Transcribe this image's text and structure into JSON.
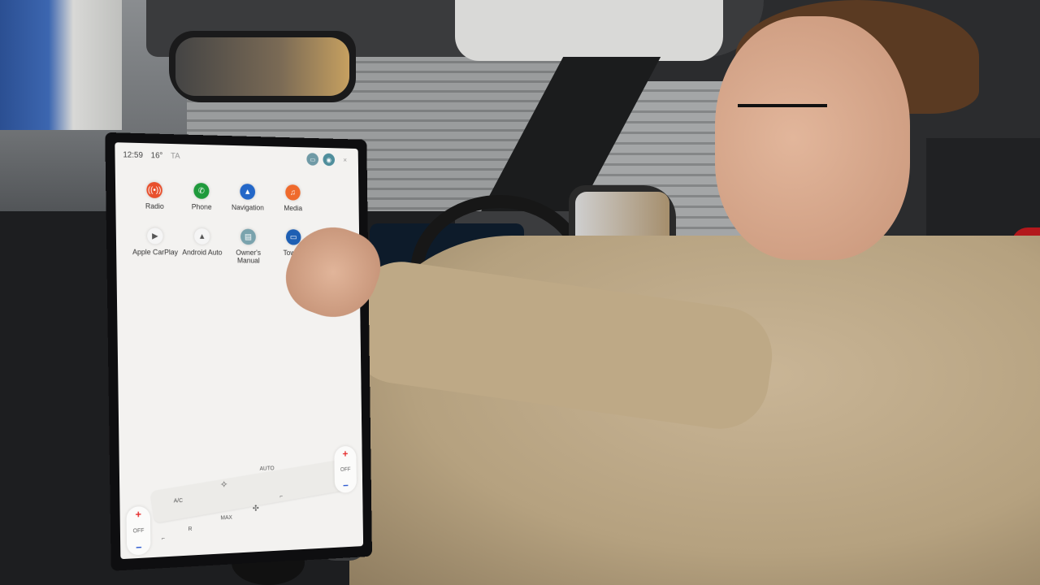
{
  "scene": {
    "description": "Driver touching a portrait infotainment touchscreen in a vehicle cabin"
  },
  "screen": {
    "status_bar": {
      "time": "12:59",
      "temperature": "16°",
      "radio_indicator": "TA",
      "icons": [
        "display-icon",
        "camera-icon",
        "close-icon"
      ],
      "close_label": "×"
    },
    "apps": [
      {
        "label": "Radio",
        "icon": "radio-icon",
        "glyph": "((•))",
        "color": "#e8502d"
      },
      {
        "label": "Phone",
        "icon": "phone-icon",
        "glyph": "✆",
        "color": "#1f9a3c"
      },
      {
        "label": "Navigation",
        "icon": "navigation-icon",
        "glyph": "▲",
        "color": "#2367c8"
      },
      {
        "label": "Media",
        "icon": "music-icon",
        "glyph": "♫",
        "color": "#ef6a2c"
      },
      {
        "label": "Apple CarPlay",
        "icon": "carplay-icon",
        "glyph": "▶",
        "color": "#f5f5f5"
      },
      {
        "label": "Android Auto",
        "icon": "android-auto-icon",
        "glyph": "▲",
        "color": "#f5f5f5"
      },
      {
        "label": "Owner's Manual",
        "icon": "manual-icon",
        "glyph": "▤",
        "color": "#7aa3ad"
      },
      {
        "label": "Towing",
        "icon": "towing-icon",
        "glyph": "▭",
        "color": "#1e5fb3"
      }
    ],
    "climate": {
      "left_temp": {
        "plus": "+",
        "label": "OFF",
        "minus": "−"
      },
      "right_temp": {
        "plus": "+",
        "label": "OFF",
        "minus": "−"
      },
      "ac_label": "A/C",
      "auto_label": "AUTO",
      "max_label": "MAX",
      "rear_label": "R",
      "fan_glyph": "✣",
      "airflow_glyph": "✧",
      "seat_glyph": "⌐"
    }
  }
}
